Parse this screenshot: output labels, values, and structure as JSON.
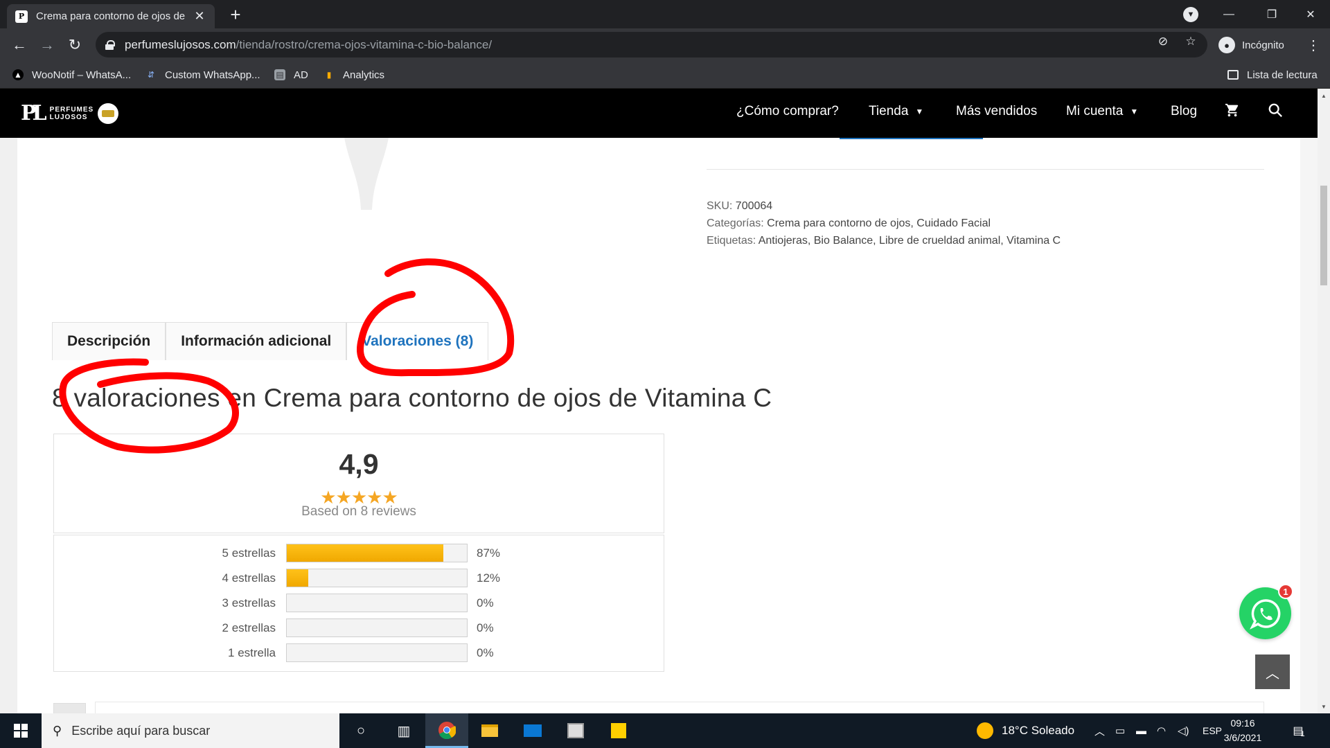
{
  "browser": {
    "tab_title": "Crema para contorno de ojos de",
    "url_host": "perfumeslujosos.com",
    "url_path": "/tienda/rostro/crema-ojos-vitamina-c-bio-balance/",
    "profile_label": "Incógnito",
    "bookmarks": [
      {
        "label": "WooNotif – WhatsA...",
        "icon": "woonotif-icon"
      },
      {
        "label": "Custom WhatsApp...",
        "icon": "custom-icon"
      },
      {
        "label": "AD",
        "icon": "ad-icon"
      },
      {
        "label": "Analytics",
        "icon": "analytics-icon"
      }
    ],
    "reading_list": "Lista de lectura"
  },
  "site": {
    "logo_line1": "PERFUMES",
    "logo_line2": "LUJOSOS",
    "nav": [
      {
        "label": "¿Cómo comprar?"
      },
      {
        "label": "Tienda"
      },
      {
        "label": "Más vendidos"
      },
      {
        "label": "Mi cuenta"
      },
      {
        "label": "Blog"
      }
    ]
  },
  "product": {
    "sku_label": "SKU:",
    "sku": "700064",
    "categories_label": "Categorías:",
    "categories": "Crema para contorno de ojos, Cuidado Facial",
    "tags_label": "Etiquetas:",
    "tags": "Antiojeras, Bio Balance, Libre de crueldad animal, Vitamina C"
  },
  "tabs": [
    {
      "label": "Descripción",
      "active": false
    },
    {
      "label": "Información adicional",
      "active": false
    },
    {
      "label": "Valoraciones (8)",
      "active": true
    }
  ],
  "reviews": {
    "title": "8 valoraciones en Crema para contorno de ojos de Vitamina C",
    "average": "4,9",
    "stars": "★★★★★",
    "based_on": "Based on 8 reviews",
    "breakdown": [
      {
        "label": "5 estrellas",
        "percent": 87,
        "percent_text": "87%"
      },
      {
        "label": "4 estrellas",
        "percent": 12,
        "percent_text": "12%"
      },
      {
        "label": "3 estrellas",
        "percent": 0,
        "percent_text": "0%"
      },
      {
        "label": "2 estrellas",
        "percent": 0,
        "percent_text": "0%"
      },
      {
        "label": "1 estrella",
        "percent": 0,
        "percent_text": "0%"
      }
    ]
  },
  "widgets": {
    "whatsapp_badge": "1"
  },
  "taskbar": {
    "search_placeholder": "Escribe aquí para buscar",
    "weather": "18°C  Soleado",
    "language": "ESP",
    "time": "09:16",
    "date": "3/6/2021",
    "notifications": "1"
  },
  "colors": {
    "accent": "#1e73be",
    "bar_fill": "#f7b500",
    "annotation": "#ff0000",
    "whatsapp": "#25d366"
  }
}
